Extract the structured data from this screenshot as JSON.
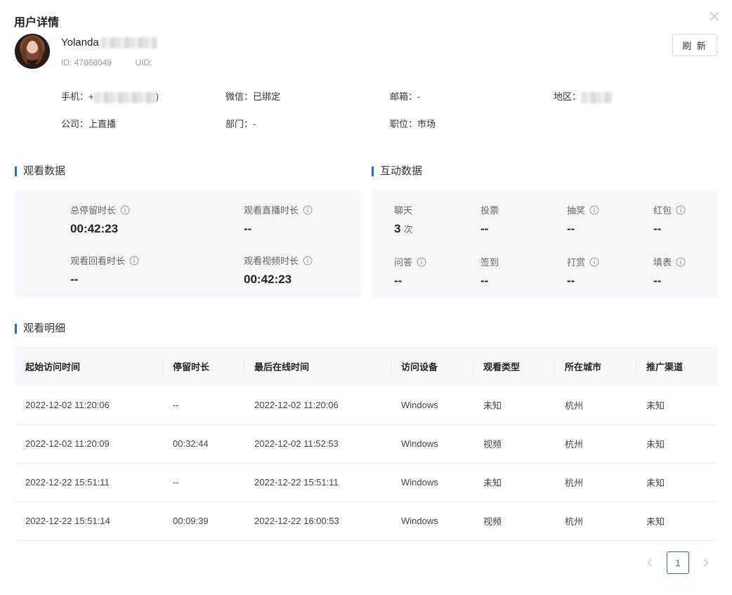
{
  "dialog": {
    "title": "用户详情"
  },
  "user": {
    "name": "Yolanda",
    "id_text": "ID: 47868049",
    "uid_text": "UID:",
    "refresh_label": "刷 新"
  },
  "info": {
    "phone_label": "手机：+",
    "phone_tail": ")",
    "wechat": "微信：已绑定",
    "email": "邮箱：-",
    "region_label": "地区：",
    "company": "公司：上直播",
    "department": "部门：-",
    "position": "职位：市场"
  },
  "watch": {
    "heading": "观看数据",
    "stats": [
      {
        "label": "总停留时长",
        "value": "00:42:23"
      },
      {
        "label": "观看直播时长",
        "value": "--"
      },
      {
        "label": "观看回看时长",
        "value": "--"
      },
      {
        "label": "观看视频时长",
        "value": "00:42:23"
      }
    ]
  },
  "interaction": {
    "heading": "互动数据",
    "stats": [
      {
        "label": "聊天",
        "value": "3",
        "unit": "次"
      },
      {
        "label": "投票",
        "value": "--"
      },
      {
        "label": "抽奖",
        "value": "--"
      },
      {
        "label": "红包",
        "value": "--"
      },
      {
        "label": "问答",
        "value": "--"
      },
      {
        "label": "签到",
        "value": "--"
      },
      {
        "label": "打赏",
        "value": "--"
      },
      {
        "label": "填表",
        "value": "--"
      }
    ]
  },
  "detail": {
    "heading": "观看明细",
    "columns": [
      "起始访问时间",
      "停留时长",
      "最后在线时间",
      "访问设备",
      "观看类型",
      "所在城市",
      "推广渠道"
    ],
    "rows": [
      [
        "2022-12-02 11:20:06",
        "--",
        "2022-12-02 11:20:06",
        "Windows",
        "未知",
        "杭州",
        "未知"
      ],
      [
        "2022-12-02 11:20:09",
        "00:32:44",
        "2022-12-02 11:52:53",
        "Windows",
        "视频",
        "杭州",
        "未知"
      ],
      [
        "2022-12-22 15:51:11",
        "--",
        "2022-12-22 15:51:11",
        "Windows",
        "未知",
        "杭州",
        "未知"
      ],
      [
        "2022-12-22 15:51:14",
        "00:09:39",
        "2022-12-22 16:00:53",
        "Windows",
        "视频",
        "杭州",
        "未知"
      ]
    ]
  },
  "pagination": {
    "current": "1"
  },
  "colors": {
    "accent": "#1a6fd8",
    "panel_bg": "#f5f7fa"
  }
}
